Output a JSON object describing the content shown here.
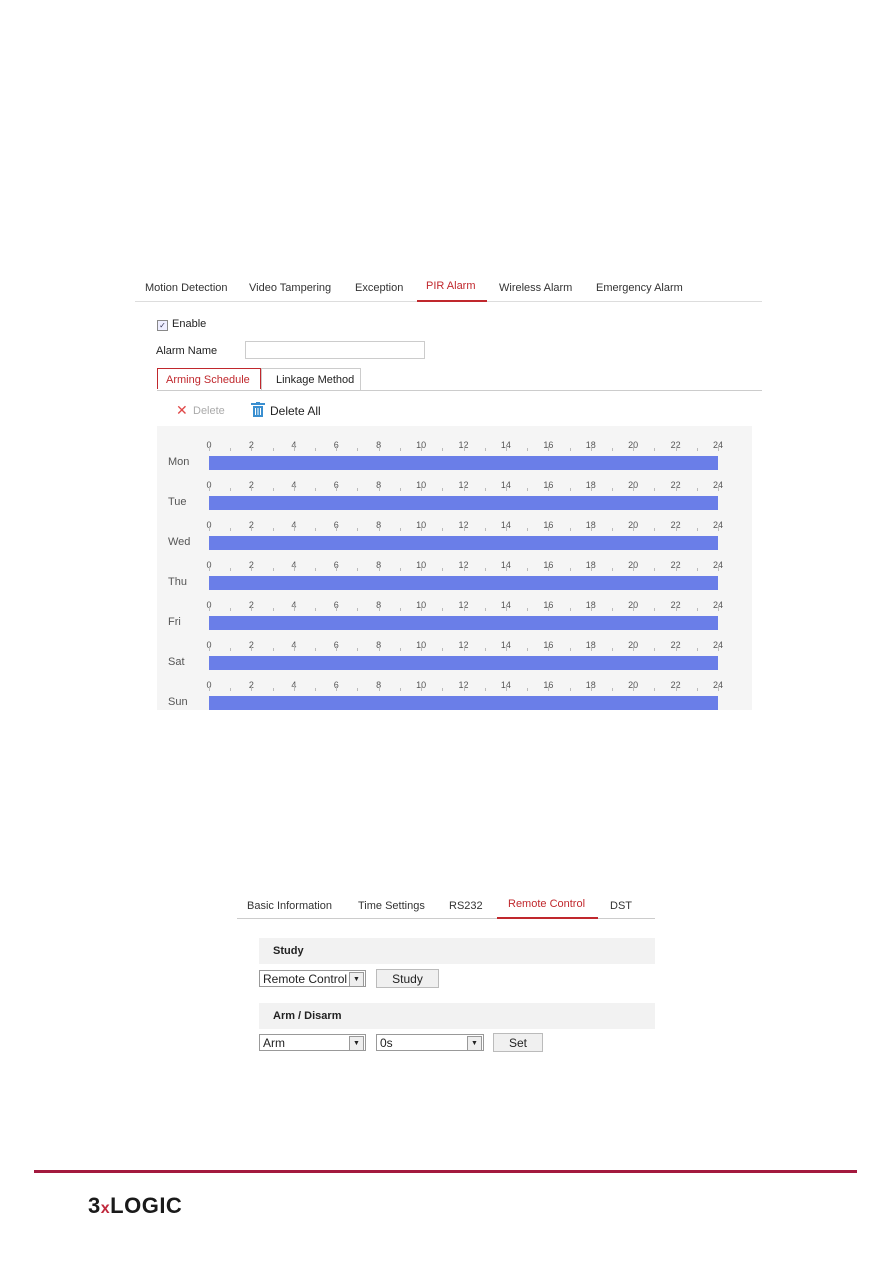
{
  "alarm_screen": {
    "tabs": [
      "Motion Detection",
      "Video Tampering",
      "Exception",
      "PIR Alarm",
      "Wireless Alarm",
      "Emergency Alarm"
    ],
    "active_tab": "PIR Alarm",
    "enable_label": "Enable",
    "enable_checked": true,
    "alarm_name_label": "Alarm Name",
    "alarm_name_value": "",
    "subtabs": {
      "arming": "Arming Schedule",
      "linkage": "Linkage Method"
    },
    "delete_label": "Delete",
    "delete_all_label": "Delete All",
    "schedule": {
      "days": [
        "Mon",
        "Tue",
        "Wed",
        "Thu",
        "Fri",
        "Sat",
        "Sun"
      ],
      "hour_labels": [
        "0",
        "2",
        "4",
        "6",
        "8",
        "10",
        "12",
        "14",
        "16",
        "18",
        "20",
        "22",
        "24"
      ],
      "armed_ranges_hours": [
        [
          0,
          24
        ],
        [
          0,
          24
        ],
        [
          0,
          24
        ],
        [
          0,
          24
        ],
        [
          0,
          24
        ],
        [
          0,
          24
        ],
        [
          0,
          24
        ]
      ],
      "bar_color": "#6a7ee8"
    }
  },
  "remote_screen": {
    "tabs": [
      "Basic Information",
      "Time Settings",
      "RS232",
      "Remote Control",
      "DST"
    ],
    "active_tab": "Remote Control",
    "study_section": "Study",
    "study_select": "Remote Control",
    "study_button": "Study",
    "arm_section": "Arm / Disarm",
    "arm_select": "Arm",
    "delay_select": "0s",
    "set_button": "Set"
  },
  "footer": {
    "logo_text": "3xLOGIC",
    "rule_color": "#a3193e"
  },
  "accent_color": "#c0282d"
}
